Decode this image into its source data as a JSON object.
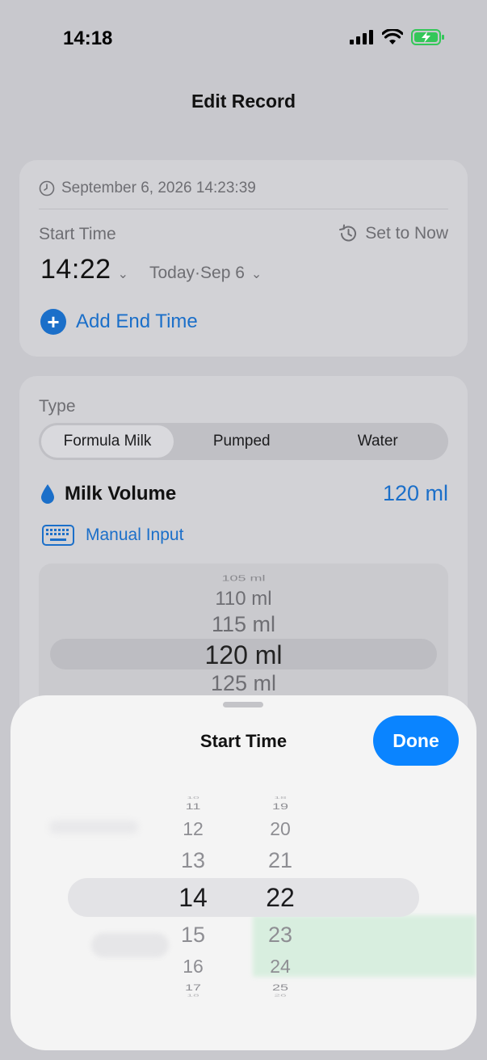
{
  "status_bar": {
    "time": "14:18"
  },
  "nav": {
    "title": "Edit Record"
  },
  "time_card": {
    "record_timestamp": "September 6, 2026 14:23:39",
    "start_time_label": "Start Time",
    "set_to_now_label": "Set to Now",
    "start_time_value": "14:22",
    "date_value": "Today·Sep 6",
    "add_end_time_label": "Add End Time"
  },
  "type_card": {
    "type_label": "Type",
    "segments": [
      "Formula Milk",
      "Pumped",
      "Water"
    ],
    "selected_segment": "Formula Milk",
    "milk_volume_label": "Milk Volume",
    "milk_volume_value": "120 ml",
    "manual_input_label": "Manual Input",
    "volume_wheel": {
      "items": [
        "105 ml",
        "110 ml",
        "115 ml",
        "120 ml",
        "125 ml"
      ],
      "selected": "120 ml"
    }
  },
  "sheet": {
    "title": "Start Time",
    "done_label": "Done",
    "hours": [
      "10",
      "11",
      "12",
      "13",
      "14",
      "15",
      "16",
      "17",
      "18"
    ],
    "minutes": [
      "18",
      "19",
      "20",
      "21",
      "22",
      "23",
      "24",
      "25",
      "26"
    ],
    "selected_hour": "14",
    "selected_minute": "22"
  },
  "colors": {
    "accent": "#1b6fc9",
    "done_button": "#0a84ff",
    "battery": "#34c759"
  }
}
